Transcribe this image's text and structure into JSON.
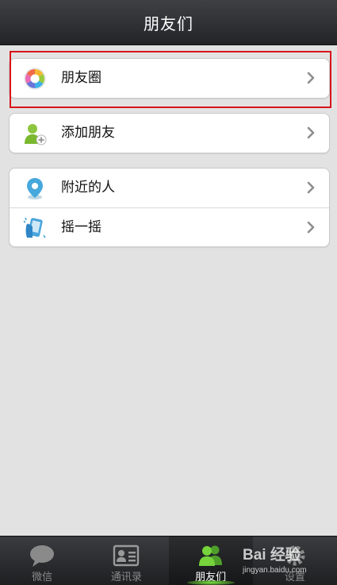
{
  "header": {
    "title": "朋友们"
  },
  "groups": [
    {
      "items": [
        {
          "label": "朋友圈",
          "icon": "moments-aperture-icon"
        }
      ]
    },
    {
      "items": [
        {
          "label": "添加朋友",
          "icon": "add-friend-icon"
        }
      ]
    },
    {
      "items": [
        {
          "label": "附近的人",
          "icon": "location-pin-icon"
        },
        {
          "label": "摇一摇",
          "icon": "shake-phone-icon"
        }
      ]
    }
  ],
  "tabbar": {
    "tabs": [
      {
        "label": "微信",
        "icon": "chat-bubble-icon",
        "active": false
      },
      {
        "label": "通讯录",
        "icon": "contacts-card-icon",
        "active": false
      },
      {
        "label": "朋友们",
        "icon": "friends-icon",
        "active": true
      },
      {
        "label": "设置",
        "icon": "settings-gear-icon",
        "active": false
      }
    ]
  },
  "watermark": {
    "main": "Bai 经验",
    "sub": "jingyan.baidu.com"
  },
  "colors": {
    "highlight": "#d8141c",
    "active_tab": "#6cc43a",
    "header": "#2c2e31"
  }
}
